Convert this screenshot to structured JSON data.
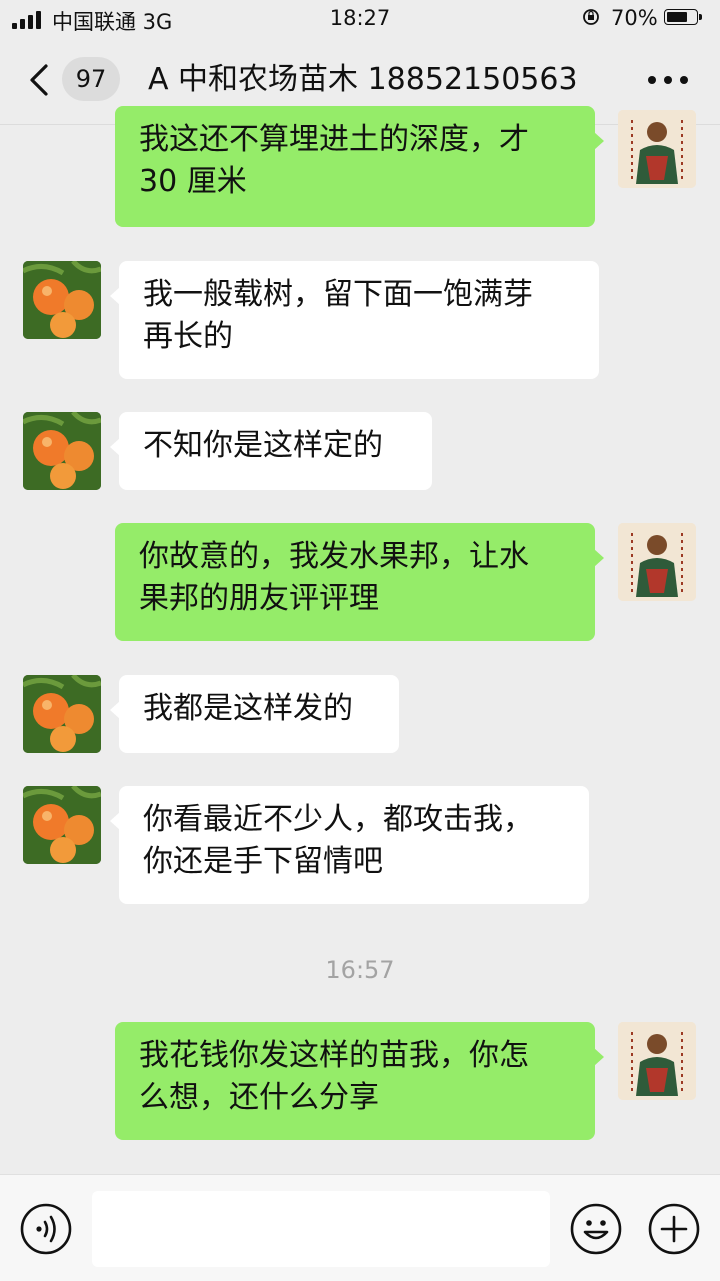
{
  "status_bar": {
    "carrier": "中国联通 3G",
    "time": "18:27",
    "battery_percent": "70%",
    "battery_level": 0.7
  },
  "navbar": {
    "unread_count": "97",
    "title": "A 中和农场苗木 18852150563"
  },
  "messages": [
    {
      "direction": "out",
      "lines": [
        "我这还不算埋进土的深度，才",
        "30 厘米"
      ]
    },
    {
      "direction": "in",
      "lines": [
        "我一般载树，留下面一饱满芽",
        "再长的"
      ]
    },
    {
      "direction": "in",
      "lines": [
        "不知你是这样定的"
      ]
    },
    {
      "direction": "out",
      "lines": [
        "你故意的，我发水果邦，让水",
        "果邦的朋友评评理"
      ]
    },
    {
      "direction": "in",
      "lines": [
        "我都是这样发的"
      ]
    },
    {
      "direction": "in",
      "lines": [
        "你看最近不少人，都攻击我，",
        "你还是手下留情吧"
      ]
    },
    {
      "direction": "out",
      "lines": [
        "我花钱你发这样的苗我，你怎",
        "么想，还什么分享"
      ]
    }
  ],
  "timestamp": "16:57",
  "input_bar": {
    "placeholder": ""
  },
  "colors": {
    "background": "#ededed",
    "outgoing_bubble": "#95ec69",
    "incoming_bubble": "#ffffff",
    "timestamp_text": "#a3a3a3"
  },
  "icons": [
    "back-icon",
    "more-icon",
    "voice-icon",
    "emoji-icon",
    "plus-icon"
  ]
}
